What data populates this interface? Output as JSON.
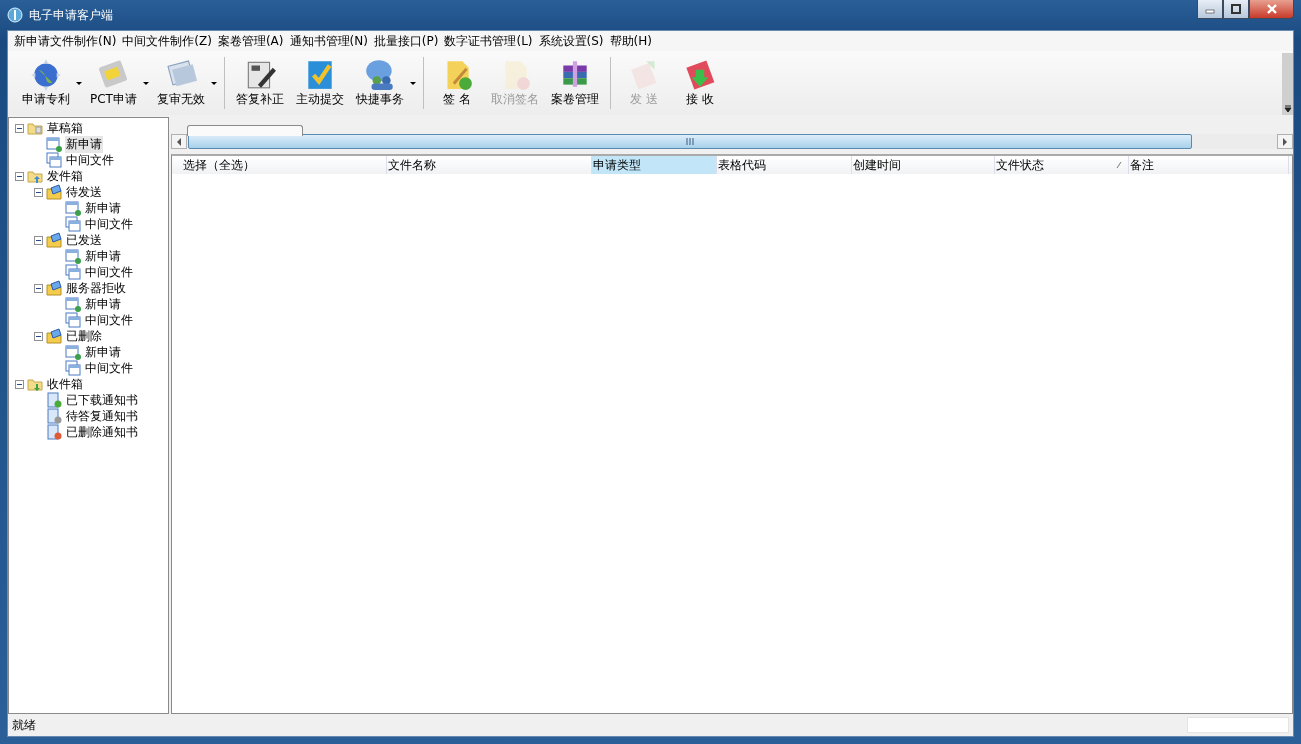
{
  "window": {
    "title": "电子申请客户端"
  },
  "menu": [
    {
      "label": "新申请文件制作(N)"
    },
    {
      "label": "中间文件制作(Z)"
    },
    {
      "label": "案卷管理(A)"
    },
    {
      "label": "通知书管理(N)"
    },
    {
      "label": "批量接口(P)"
    },
    {
      "label": "数字证书管理(L)"
    },
    {
      "label": "系统设置(S)"
    },
    {
      "label": "帮助(H)"
    }
  ],
  "toolbar": [
    {
      "kind": "button",
      "label": "申请专利",
      "disabled": false,
      "dropdown": true
    },
    {
      "kind": "button",
      "label": "PCT申请",
      "disabled": false,
      "dropdown": true
    },
    {
      "kind": "button",
      "label": "复审无效",
      "disabled": false,
      "dropdown": true
    },
    {
      "kind": "separator"
    },
    {
      "kind": "button",
      "label": "答复补正",
      "disabled": false,
      "dropdown": false
    },
    {
      "kind": "button",
      "label": "主动提交",
      "disabled": false,
      "dropdown": false
    },
    {
      "kind": "button",
      "label": "快捷事务",
      "disabled": false,
      "dropdown": true
    },
    {
      "kind": "separator"
    },
    {
      "kind": "button",
      "label": "签 名",
      "disabled": false,
      "dropdown": false
    },
    {
      "kind": "button",
      "label": "取消签名",
      "disabled": true,
      "dropdown": false
    },
    {
      "kind": "button",
      "label": "案卷管理",
      "disabled": false,
      "dropdown": false
    },
    {
      "kind": "separator"
    },
    {
      "kind": "button",
      "label": "发 送",
      "disabled": true,
      "dropdown": false
    },
    {
      "kind": "button",
      "label": "接 收",
      "disabled": false,
      "dropdown": false
    }
  ],
  "tree": [
    {
      "label": "草稿箱",
      "kind": "draft",
      "expanded": true,
      "selected": false,
      "children": [
        {
          "label": "新申请",
          "kind": "new",
          "selected": true
        },
        {
          "label": "中间文件",
          "kind": "file",
          "selected": false
        }
      ]
    },
    {
      "label": "发件箱",
      "kind": "outbox",
      "expanded": true,
      "selected": false,
      "children": [
        {
          "label": "待发送",
          "kind": "folder",
          "expanded": true,
          "selected": false,
          "children": [
            {
              "label": "新申请",
              "kind": "new",
              "selected": false
            },
            {
              "label": "中间文件",
              "kind": "file",
              "selected": false
            }
          ]
        },
        {
          "label": "已发送",
          "kind": "folder",
          "expanded": true,
          "selected": false,
          "children": [
            {
              "label": "新申请",
              "kind": "new",
              "selected": false
            },
            {
              "label": "中间文件",
              "kind": "file",
              "selected": false
            }
          ]
        },
        {
          "label": "服务器拒收",
          "kind": "folder",
          "expanded": true,
          "selected": false,
          "children": [
            {
              "label": "新申请",
              "kind": "new",
              "selected": false
            },
            {
              "label": "中间文件",
              "kind": "file",
              "selected": false
            }
          ]
        },
        {
          "label": "已删除",
          "kind": "folder",
          "expanded": true,
          "selected": false,
          "children": [
            {
              "label": "新申请",
              "kind": "new",
              "selected": false
            },
            {
              "label": "中间文件",
              "kind": "file",
              "selected": false
            }
          ]
        }
      ]
    },
    {
      "label": "收件箱",
      "kind": "inbox",
      "expanded": true,
      "selected": false,
      "children": [
        {
          "label": "已下载通知书",
          "kind": "notice-down",
          "selected": false
        },
        {
          "label": "待答复通知书",
          "kind": "notice-gear",
          "selected": false
        },
        {
          "label": "已删除通知书",
          "kind": "notice-del",
          "selected": false
        }
      ]
    }
  ],
  "table": {
    "columns": [
      {
        "label": "选择（全选）",
        "selected": false,
        "sorted": false
      },
      {
        "label": "文件名称",
        "selected": false,
        "sorted": false
      },
      {
        "label": "申请类型",
        "selected": true,
        "sorted": false
      },
      {
        "label": "表格代码",
        "selected": false,
        "sorted": false
      },
      {
        "label": "创建时间",
        "selected": false,
        "sorted": false
      },
      {
        "label": "文件状态",
        "selected": false,
        "sorted": true
      },
      {
        "label": "备注",
        "selected": false,
        "sorted": false
      }
    ]
  },
  "status_bar": {
    "text": "就绪"
  }
}
